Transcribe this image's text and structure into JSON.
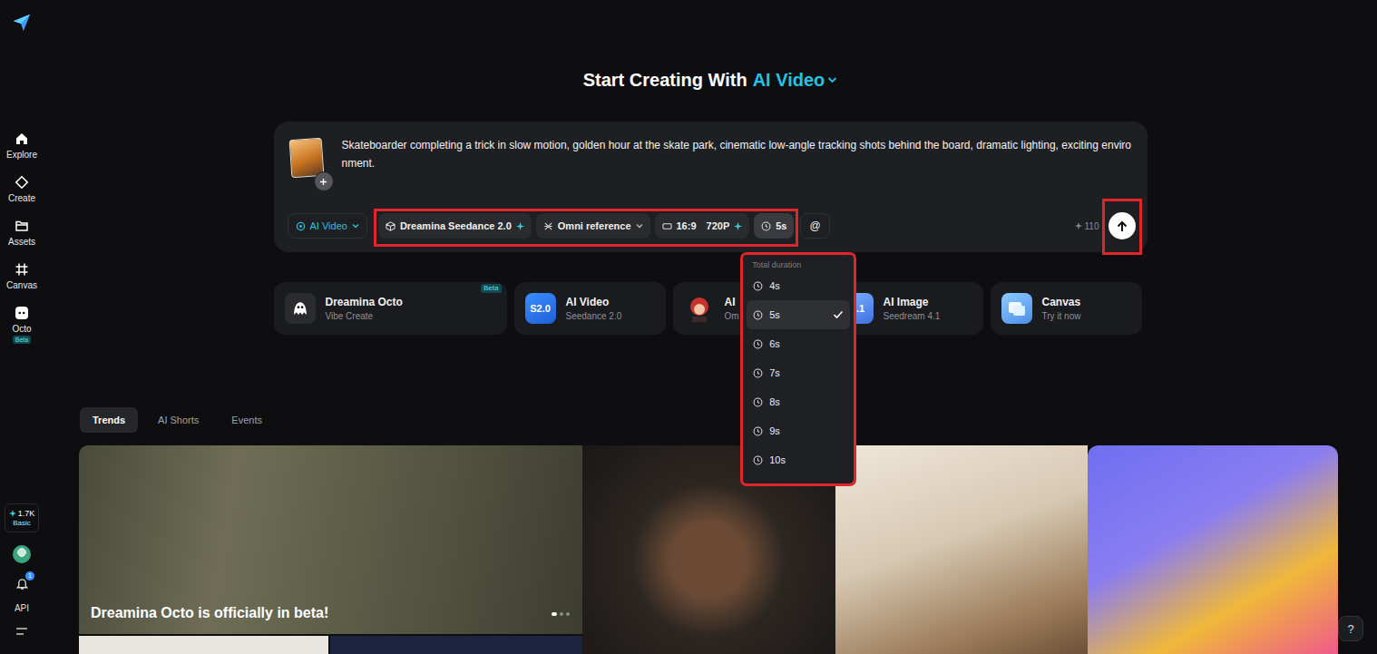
{
  "sidebar": {
    "items": [
      {
        "label": "Explore",
        "selected": false
      },
      {
        "label": "Create",
        "selected": false
      },
      {
        "label": "Assets",
        "selected": false
      },
      {
        "label": "Canvas",
        "selected": false
      },
      {
        "label": "Octo",
        "selected": false,
        "badge": "Beta"
      }
    ],
    "credits": {
      "amount": "1.7K",
      "plan": "Basic"
    },
    "notifications": {
      "count": "1"
    },
    "api": "API"
  },
  "heading": {
    "prefix": "Start Creating With",
    "mode": "AI Video"
  },
  "prompt": {
    "text": "Skateboarder completing a trick in slow motion, golden hour at the skate park, cinematic low-angle tracking shots behind the board, dramatic lighting, exciting environment.",
    "mode": "AI Video",
    "model": "Dreamina Seedance 2.0",
    "reference": "Omni reference",
    "ratio": "16:9",
    "resolution": "720P",
    "duration": "5s",
    "duration_open": true,
    "mention": "@",
    "cost": "110"
  },
  "duration_menu": {
    "title": "Total duration",
    "options": [
      {
        "label": "4s",
        "selected": false
      },
      {
        "label": "5s",
        "selected": true
      },
      {
        "label": "6s",
        "selected": false
      },
      {
        "label": "7s",
        "selected": false
      },
      {
        "label": "8s",
        "selected": false
      },
      {
        "label": "9s",
        "selected": false
      },
      {
        "label": "10s",
        "selected": false
      }
    ]
  },
  "shortcuts": [
    {
      "title": "Dreamina Octo",
      "subtitle": "Vibe Create",
      "badge": "Beta",
      "icon_label": ""
    },
    {
      "title": "AI Video",
      "subtitle": "Seedance 2.0",
      "badge": "",
      "icon_label": "S2.0"
    },
    {
      "title": "AI",
      "subtitle": "Om",
      "badge": "",
      "icon_label": ""
    },
    {
      "title": "AI Image",
      "subtitle": "Seedream 4.1",
      "badge": "",
      "icon_label": "4.1"
    },
    {
      "title": "Canvas",
      "subtitle": "Try it now",
      "badge": "",
      "icon_label": ""
    }
  ],
  "tabs": [
    {
      "label": "Trends",
      "selected": true
    },
    {
      "label": "AI Shorts",
      "selected": false
    },
    {
      "label": "Events",
      "selected": false
    }
  ],
  "gallery": [
    {
      "kind": "banner",
      "caption": "Dreamina Octo is officially in beta!",
      "slides": [
        {
          "selected": true
        },
        {
          "selected": false
        },
        {
          "selected": false
        }
      ]
    },
    {
      "kind": "picture",
      "caption": "",
      "slides": []
    },
    {
      "kind": "picture",
      "caption": "",
      "slides": []
    },
    {
      "kind": "picture",
      "caption": "",
      "slides": []
    }
  ],
  "help": "?"
}
